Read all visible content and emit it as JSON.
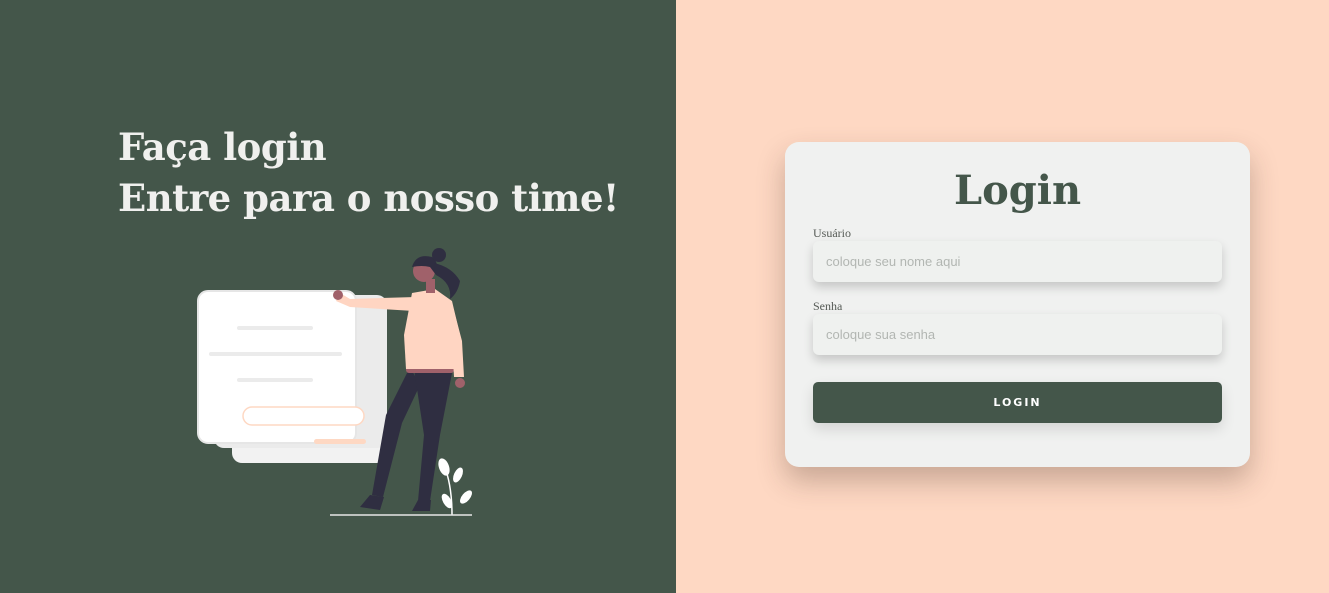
{
  "hero": {
    "line1": "Faça login",
    "line2": "Entre para o nosso time!"
  },
  "login_card": {
    "title": "Login",
    "username": {
      "label": "Usuário",
      "placeholder": "coloque seu nome aqui",
      "value": ""
    },
    "password": {
      "label": "Senha",
      "placeholder": "coloque sua senha",
      "value": ""
    },
    "button_label": "LOGIN"
  },
  "colors": {
    "left_panel": "#44564a",
    "right_panel": "#fed8c3",
    "card": "#f0f1f0",
    "accent": "#44564a"
  },
  "illustration": {
    "name": "woman-with-form-illustration"
  }
}
